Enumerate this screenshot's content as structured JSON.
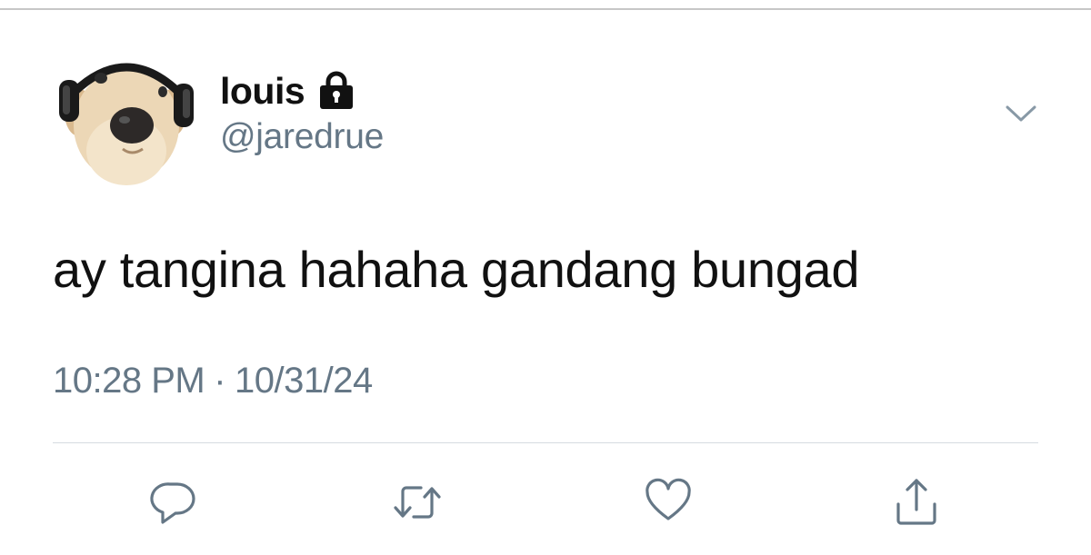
{
  "tweet": {
    "display_name": "louis",
    "handle": "@jaredrue",
    "text": "ay tangina hahaha gandang bungad",
    "time": "10:28 PM",
    "separator": "·",
    "date": "10/31/24",
    "protected": true
  },
  "icons": {
    "lock": "lock-icon",
    "more": "chevron-down-icon",
    "reply": "reply-icon",
    "retweet": "retweet-icon",
    "like": "heart-icon",
    "share": "share-icon"
  },
  "colors": {
    "text": "#111111",
    "secondary": "#657786",
    "icon": "#657786",
    "divider": "#d6dbe0"
  }
}
